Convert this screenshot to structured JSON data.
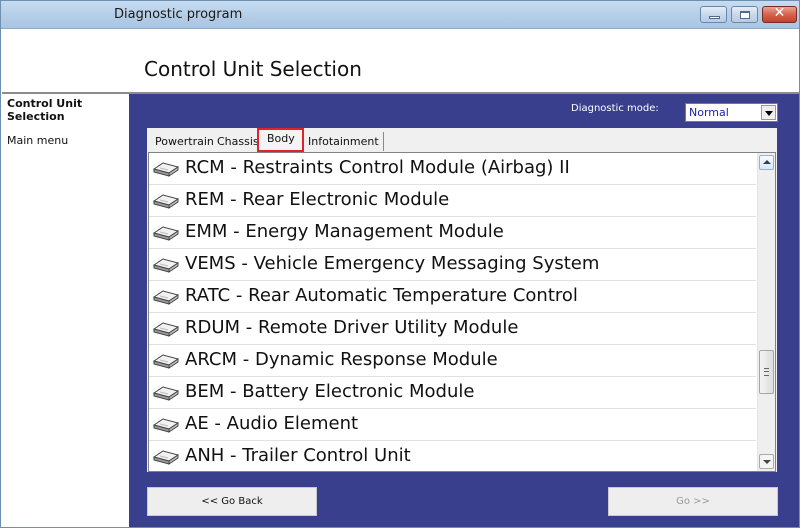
{
  "window": {
    "title": "Diagnostic program",
    "controls": {
      "minimize": "minimize",
      "maximize": "maximize",
      "close": "✕"
    }
  },
  "header": {
    "title": "Control Unit Selection"
  },
  "sidebar": {
    "current": "Control Unit Selection",
    "main_menu": "Main menu"
  },
  "diagnostic_mode": {
    "label": "Diagnostic mode:",
    "selected": "Normal"
  },
  "tabs": [
    {
      "label": "Powertrain",
      "active": false
    },
    {
      "label": "Chassis",
      "active": false
    },
    {
      "label": "Body",
      "active": true
    },
    {
      "label": "Infotainment",
      "active": false
    }
  ],
  "modules": [
    {
      "label": "RCM - Restraints Control Module (Airbag) II",
      "icon": "module-icon"
    },
    {
      "label": "REM - Rear Electronic Module",
      "icon": "module-icon"
    },
    {
      "label": "EMM - Energy Management Module",
      "icon": "module-icon"
    },
    {
      "label": "VEMS - Vehicle Emergency Messaging System",
      "icon": "module-icon"
    },
    {
      "label": "RATC - Rear Automatic Temperature Control",
      "icon": "module-icon"
    },
    {
      "label": "RDUM - Remote Driver Utility Module",
      "icon": "module-icon"
    },
    {
      "label": "ARCM - Dynamic Response Module",
      "icon": "module-icon"
    },
    {
      "label": "BEM - Battery Electronic Module",
      "icon": "module-icon"
    },
    {
      "label": "AE - Audio Element",
      "icon": "module-icon"
    },
    {
      "label": "ANH - Trailer Control Unit",
      "icon": "module-icon"
    }
  ],
  "scroll": {
    "position_fraction": 0.75
  },
  "buttons": {
    "back": "<< Go Back",
    "go": "Go >>",
    "go_enabled": false
  },
  "colors": {
    "main_background": "#393f8d",
    "tab_highlight": "#e0222a"
  }
}
